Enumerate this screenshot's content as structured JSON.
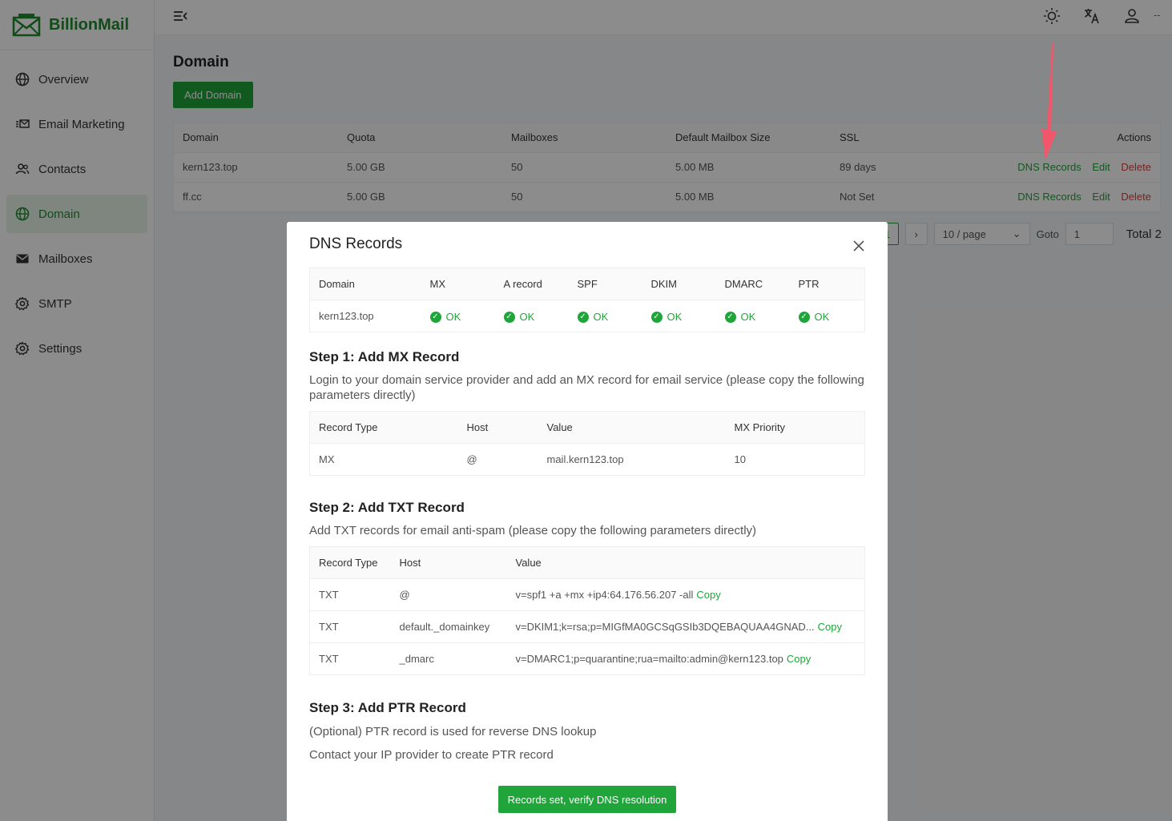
{
  "app": {
    "name": "BillionMail",
    "header_user_text": "--"
  },
  "sidebar": {
    "items": [
      {
        "label": "Overview",
        "icon": "globe-icon"
      },
      {
        "label": "Email Marketing",
        "icon": "email-list-icon"
      },
      {
        "label": "Contacts",
        "icon": "contacts-icon"
      },
      {
        "label": "Domain",
        "icon": "globe-icon",
        "active": true
      },
      {
        "label": "Mailboxes",
        "icon": "mail-icon"
      },
      {
        "label": "SMTP",
        "icon": "gear-icon"
      },
      {
        "label": "Settings",
        "icon": "gear-icon"
      }
    ]
  },
  "main": {
    "title": "Domain",
    "add_button": "Add Domain",
    "table": {
      "headers": [
        "Domain",
        "Quota",
        "Mailboxes",
        "Default Mailbox Size",
        "SSL",
        "Actions"
      ],
      "rows": [
        {
          "domain": "kern123.top",
          "quota": "5.00 GB",
          "mailboxes": "50",
          "size": "5.00 MB",
          "ssl": "89 days",
          "ssl_status": "valid"
        },
        {
          "domain": "ff.cc",
          "quota": "5.00 GB",
          "mailboxes": "50",
          "size": "5.00 MB",
          "ssl": "Not Set",
          "ssl_status": "none"
        }
      ],
      "actions": {
        "dns": "DNS Records",
        "edit": "Edit",
        "delete": "Delete"
      }
    },
    "pagination": {
      "current": "1",
      "page_size": "10 / page",
      "goto_label": "Goto",
      "goto_value": "1",
      "total": "Total 2"
    }
  },
  "modal": {
    "title": "DNS Records",
    "status_table": {
      "headers": [
        "Domain",
        "MX",
        "A record",
        "SPF",
        "DKIM",
        "DMARC",
        "PTR"
      ],
      "row": {
        "domain": "kern123.top",
        "statuses": [
          "OK",
          "OK",
          "OK",
          "OK",
          "OK",
          "OK"
        ]
      }
    },
    "step1": {
      "title": "Step 1: Add MX Record",
      "desc": "Login to your domain service provider and add an MX record for email service (please copy the following parameters directly)",
      "headers": [
        "Record Type",
        "Host",
        "Value",
        "MX Priority"
      ],
      "row": [
        "MX",
        "@",
        "mail.kern123.top",
        "10"
      ]
    },
    "step2": {
      "title": "Step 2: Add TXT Record",
      "desc": "Add TXT records for email anti-spam (please copy the following parameters directly)",
      "headers": [
        "Record Type",
        "Host",
        "Value"
      ],
      "rows": [
        {
          "type": "TXT",
          "host": "@",
          "value": "v=spf1 +a +mx +ip4:64.176.56.207 -all"
        },
        {
          "type": "TXT",
          "host": "default._domainkey",
          "value": "v=DKIM1;k=rsa;p=MIGfMA0GCSqGSIb3DQEBAQUAA4GNAD..."
        },
        {
          "type": "TXT",
          "host": "_dmarc",
          "value": "v=DMARC1;p=quarantine;rua=mailto:admin@kern123.top"
        }
      ],
      "copy_label": "Copy"
    },
    "step3": {
      "title": "Step 3: Add PTR Record",
      "line1": "(Optional) PTR record is used for reverse DNS lookup",
      "line2": "Contact your IP provider to create PTR record"
    },
    "verify_button": "Records set, verify DNS resolution"
  },
  "colors": {
    "brand": "#20a53a",
    "danger": "#e53935",
    "warning": "#e6a23c",
    "annotation_arrow": "#f2566a"
  }
}
